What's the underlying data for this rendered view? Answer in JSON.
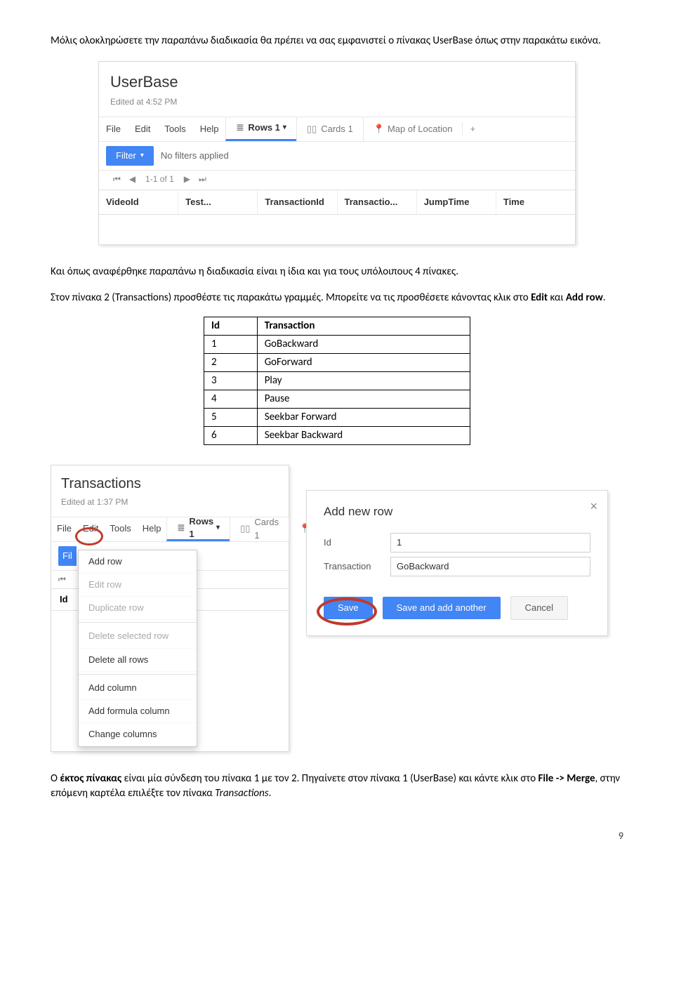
{
  "intro": {
    "p1a": "Μόλις ολοκληρώσετε την παραπάνω διαδικασία θα πρέπει να σας εμφανιστεί ο πίνακας UserBase όπως στην παρακάτω εικόνα."
  },
  "shot1": {
    "title": "UserBase",
    "edited": "Edited at 4:52 PM",
    "menu": {
      "file": "File",
      "edit": "Edit",
      "tools": "Tools",
      "help": "Help"
    },
    "tabs": {
      "rows": "Rows 1",
      "cards": "Cards 1",
      "map": "Map of Location"
    },
    "filter_btn": "Filter",
    "filter_status": "No filters applied",
    "pager": "1-1 of 1",
    "cols": {
      "c1": "VideoId",
      "c2": "Test...",
      "c3": "TransactionId",
      "c4": "Transactio...",
      "c5": "JumpTime",
      "c6": "Time"
    }
  },
  "mid": {
    "p2a": "Και όπως αναφέρθηκε παραπάνω η διαδικασία είναι η ίδια και για τους υπόλοιπους 4 πίνακες.",
    "p3": "Στον πίνακα 2 (Transactions) προσθέστε τις παρακάτω γραμμές. Μπορείτε να τις προσθέσετε κάνοντας κλικ στο ",
    "p3b": "Edit",
    "p3c": " και ",
    "p3d": "Add row",
    "p3e": "."
  },
  "deftable": {
    "h1": "Id",
    "h2": "Transaction",
    "rows": [
      {
        "id": "1",
        "tx": "GoBackward"
      },
      {
        "id": "2",
        "tx": "GoForward"
      },
      {
        "id": "3",
        "tx": "Play"
      },
      {
        "id": "4",
        "tx": "Pause"
      },
      {
        "id": "5",
        "tx": "Seekbar Forward"
      },
      {
        "id": "6",
        "tx": "Seekbar Backward"
      }
    ]
  },
  "shot2": {
    "title": "Transactions",
    "edited": "Edited at 1:37 PM",
    "menu": {
      "file": "File",
      "edit": "Edit",
      "tools": "Tools",
      "help": "Help"
    },
    "tabs": {
      "rows": "Rows 1",
      "cards": "Cards 1"
    },
    "filter_label": "Fil",
    "colhead": "Id",
    "dropdown": {
      "d1": "Add row",
      "d2": "Edit row",
      "d3": "Duplicate row",
      "d4": "Delete selected row",
      "d5": "Delete all rows",
      "d6": "Add column",
      "d7": "Add formula column",
      "d8": "Change columns"
    }
  },
  "shot3": {
    "title": "Add new row",
    "lbl_id": "Id",
    "lbl_tx": "Transaction",
    "val_id": "1",
    "val_tx": "GoBackward",
    "btn_save": "Save",
    "btn_saveadd": "Save and add another",
    "btn_cancel": "Cancel"
  },
  "outro": {
    "p4a": "Ο ",
    "p4b": "έκτος πίνακας",
    "p4c": " είναι μία σύνδεση του πίνακα 1 με τον 2. Πηγαίνετε στον πίνακα 1 (UserBase) και κάντε κλικ στο ",
    "p4d": "File -> Merge",
    "p4e": ", στην επόμενη καρτέλα επιλέξτε τον πίνακα ",
    "p4f": "Transactions",
    "p4g": "."
  },
  "pagenum": "9"
}
